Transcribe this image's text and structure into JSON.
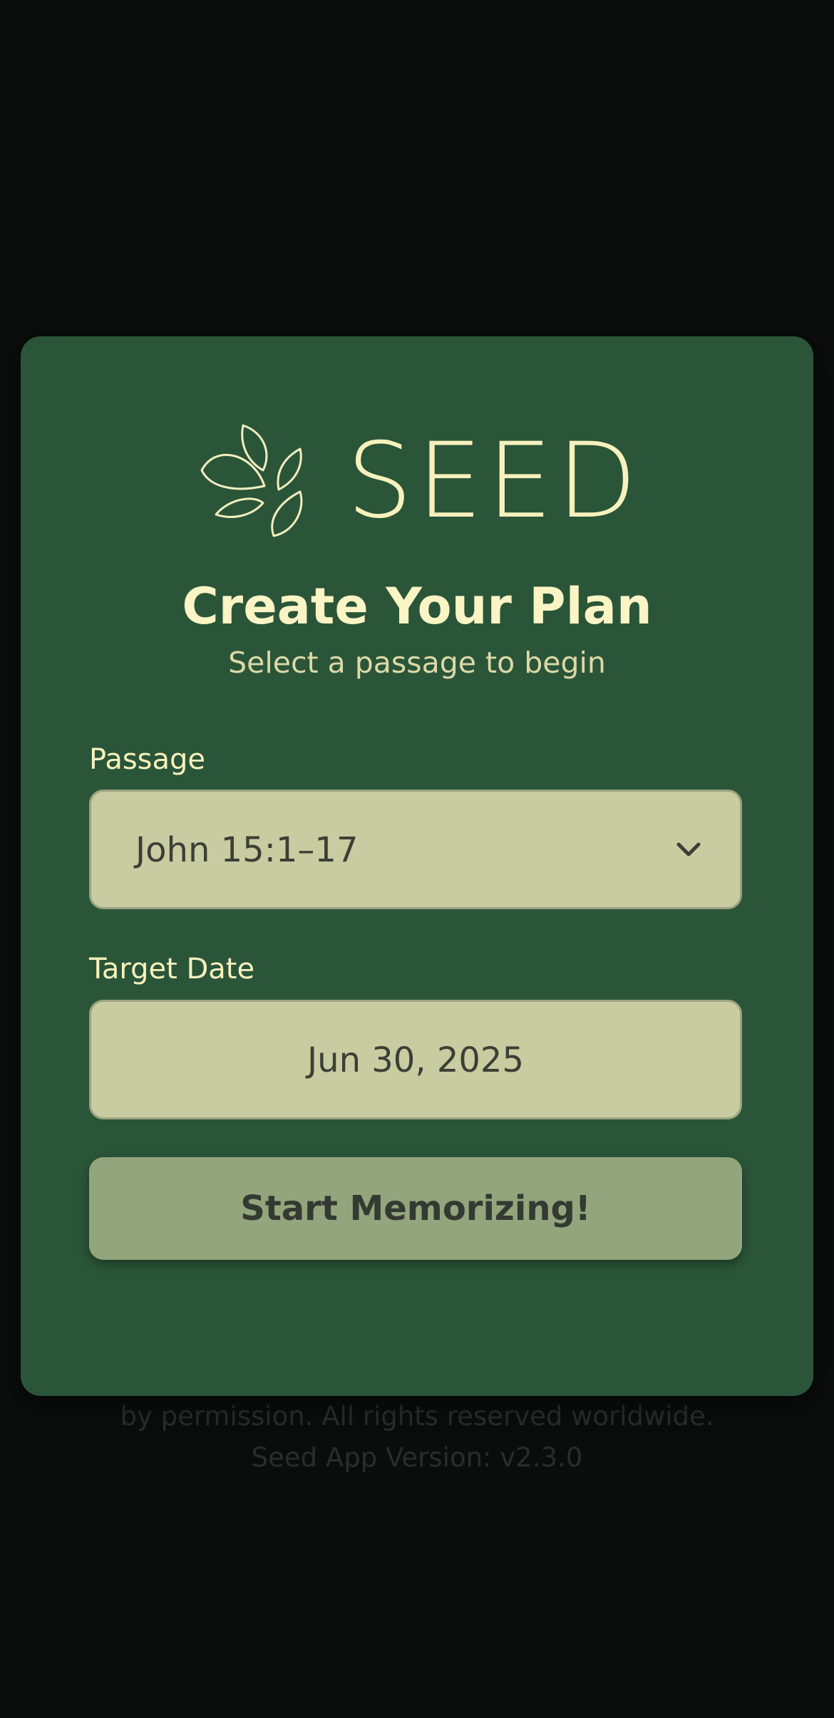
{
  "app": {
    "logo_text": "SEED",
    "logo_icon": "leaves-icon"
  },
  "dialog": {
    "title": "Create Your Plan",
    "subtitle": "Select a passage to begin",
    "passage": {
      "label": "Passage",
      "value": "John 15:1–17",
      "icon": "chevron-down-icon"
    },
    "target_date": {
      "label": "Target Date",
      "value": "Jun 30, 2025"
    },
    "start_button_label": "Start Memorizing!"
  },
  "footer": {
    "line1": "by permission. All rights reserved worldwide.",
    "line2": "Seed App Version: v2.3.0"
  },
  "colors": {
    "background": "#0b0c0c",
    "dialog_bg": "#2a5538",
    "accent_cream": "#f7f1bd",
    "input_bg": "#c9cca0",
    "button_bg": "#93a57c"
  }
}
